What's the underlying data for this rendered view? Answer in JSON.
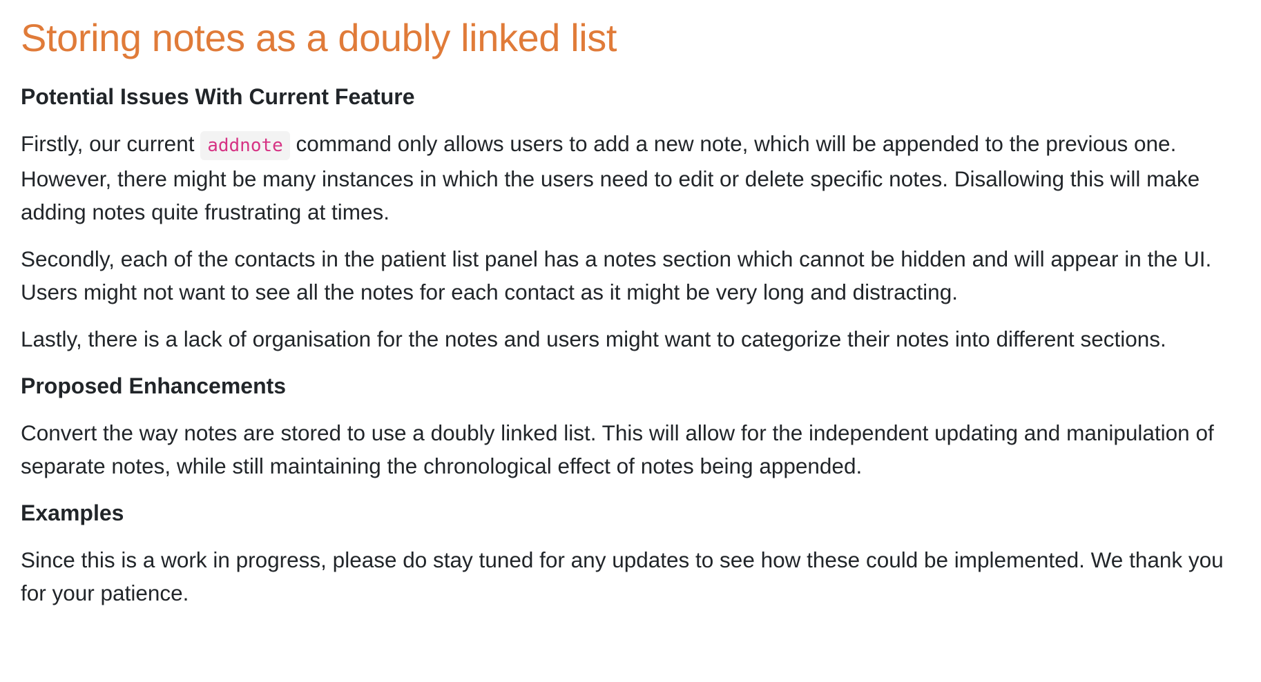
{
  "title": "Storing notes as a doubly linked list",
  "sections": [
    {
      "heading": "Potential Issues With Current Feature",
      "paragraphs": [
        {
          "before_code": "Firstly, our current ",
          "code": "addnote",
          "after_code": " command only allows users to add a new note, which will be appended to the previous one. However, there might be many instances in which the users need to edit or delete specific notes. Disallowing this will make adding notes quite frustrating at times."
        },
        {
          "text": "Secondly, each of the contacts in the patient list panel has a notes section which cannot be hidden and will appear in the UI. Users might not want to see all the notes for each contact as it might be very long and distracting."
        },
        {
          "text": "Lastly, there is a lack of organisation for the notes and users might want to categorize their notes into different sections."
        }
      ]
    },
    {
      "heading": "Proposed Enhancements",
      "paragraphs": [
        {
          "text": "Convert the way notes are stored to use a doubly linked list. This will allow for the independent updating and manipulation of separate notes, while still maintaining the chronological effect of notes being appended."
        }
      ]
    },
    {
      "heading": "Examples",
      "paragraphs": [
        {
          "text": "Since this is a work in progress, please do stay tuned for any updates to see how these could be implemented. We thank you for your patience."
        }
      ]
    }
  ],
  "colors": {
    "title": "#e07b39",
    "body_text": "#212529",
    "code_text": "#d63384",
    "code_background": "#f3f3f3"
  }
}
